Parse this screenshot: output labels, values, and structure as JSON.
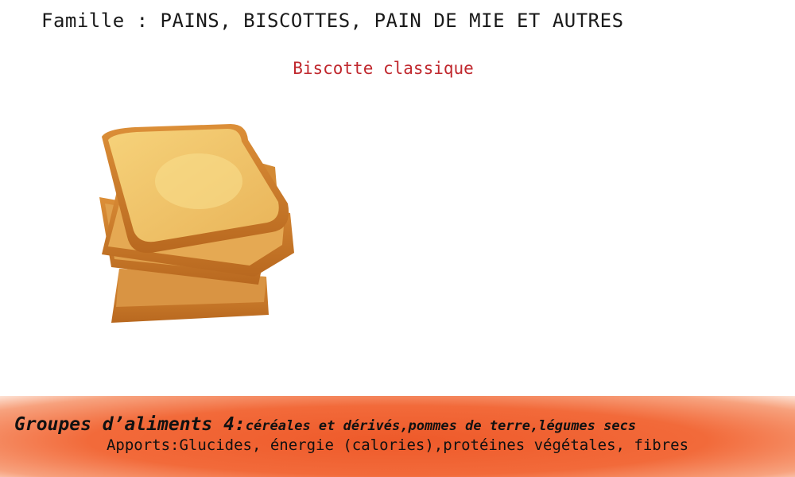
{
  "header": {
    "family_title": "Famille : PAINS, BISCOTTES, PAIN DE MIE ET AUTRES"
  },
  "product": {
    "name": "Biscotte classique"
  },
  "footer": {
    "group_label": "Groupes d’aliments 4:",
    "group_detail": "céréales et dérivés,pommes de terre,légumes secs",
    "contributions": "Apports:Glucides, énergie (calories),protéines végétales, fibres"
  },
  "colors": {
    "accent_red": "#c0282e",
    "band_orange": "#ee5a2a"
  }
}
